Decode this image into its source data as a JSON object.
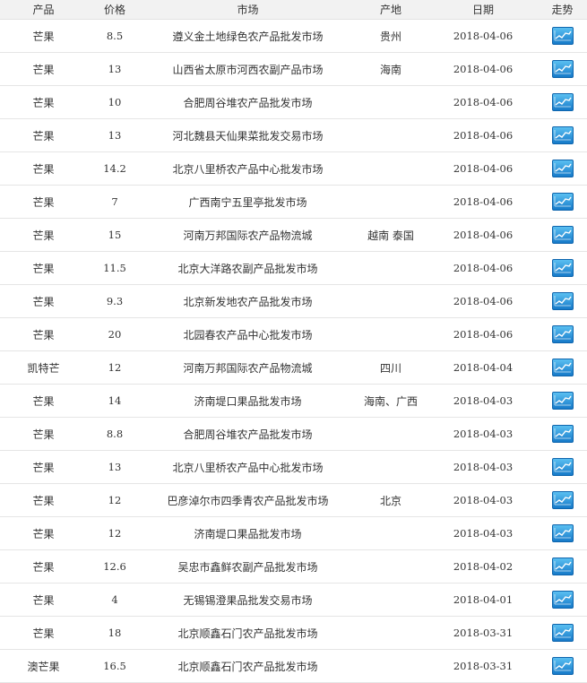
{
  "headers": {
    "product": "产品",
    "price": "价格",
    "market": "市场",
    "origin": "产地",
    "date": "日期",
    "trend": "走势"
  },
  "trend_icon": "trend-chart-icon",
  "colors": {
    "header_bg": "#f2f2f2",
    "row_border": "#e5e5e5",
    "icon_blue": "#1d8fd6"
  },
  "rows": [
    {
      "product": "芒果",
      "price": "8.5",
      "market": "遵义金土地绿色农产品批发市场",
      "origin": "贵州",
      "date": "2018-04-06"
    },
    {
      "product": "芒果",
      "price": "13",
      "market": "山西省太原市河西农副产品市场",
      "origin": "海南",
      "date": "2018-04-06"
    },
    {
      "product": "芒果",
      "price": "10",
      "market": "合肥周谷堆农产品批发市场",
      "origin": "",
      "date": "2018-04-06"
    },
    {
      "product": "芒果",
      "price": "13",
      "market": "河北魏县天仙果菜批发交易市场",
      "origin": "",
      "date": "2018-04-06"
    },
    {
      "product": "芒果",
      "price": "14.2",
      "market": "北京八里桥农产品中心批发市场",
      "origin": "",
      "date": "2018-04-06"
    },
    {
      "product": "芒果",
      "price": "7",
      "market": "广西南宁五里亭批发市场",
      "origin": "",
      "date": "2018-04-06"
    },
    {
      "product": "芒果",
      "price": "15",
      "market": "河南万邦国际农产品物流城",
      "origin": "越南 泰国",
      "date": "2018-04-06"
    },
    {
      "product": "芒果",
      "price": "11.5",
      "market": "北京大洋路农副产品批发市场",
      "origin": "",
      "date": "2018-04-06"
    },
    {
      "product": "芒果",
      "price": "9.3",
      "market": "北京新发地农产品批发市场",
      "origin": "",
      "date": "2018-04-06"
    },
    {
      "product": "芒果",
      "price": "20",
      "market": "北园春农产品中心批发市场",
      "origin": "",
      "date": "2018-04-06"
    },
    {
      "product": "凯特芒",
      "price": "12",
      "market": "河南万邦国际农产品物流城",
      "origin": "四川",
      "date": "2018-04-04"
    },
    {
      "product": "芒果",
      "price": "14",
      "market": "济南堤口果品批发市场",
      "origin": "海南、广西",
      "date": "2018-04-03"
    },
    {
      "product": "芒果",
      "price": "8.8",
      "market": "合肥周谷堆农产品批发市场",
      "origin": "",
      "date": "2018-04-03"
    },
    {
      "product": "芒果",
      "price": "13",
      "market": "北京八里桥农产品中心批发市场",
      "origin": "",
      "date": "2018-04-03"
    },
    {
      "product": "芒果",
      "price": "12",
      "market": "巴彦淖尔市四季青农产品批发市场",
      "origin": "北京",
      "date": "2018-04-03"
    },
    {
      "product": "芒果",
      "price": "12",
      "market": "济南堤口果品批发市场",
      "origin": "",
      "date": "2018-04-03"
    },
    {
      "product": "芒果",
      "price": "12.6",
      "market": "吴忠市鑫鲜农副产品批发市场",
      "origin": "",
      "date": "2018-04-02"
    },
    {
      "product": "芒果",
      "price": "4",
      "market": "无锡锡澄果品批发交易市场",
      "origin": "",
      "date": "2018-04-01"
    },
    {
      "product": "芒果",
      "price": "18",
      "market": "北京顺鑫石门农产品批发市场",
      "origin": "",
      "date": "2018-03-31"
    },
    {
      "product": "澳芒果",
      "price": "16.5",
      "market": "北京顺鑫石门农产品批发市场",
      "origin": "",
      "date": "2018-03-31"
    }
  ]
}
